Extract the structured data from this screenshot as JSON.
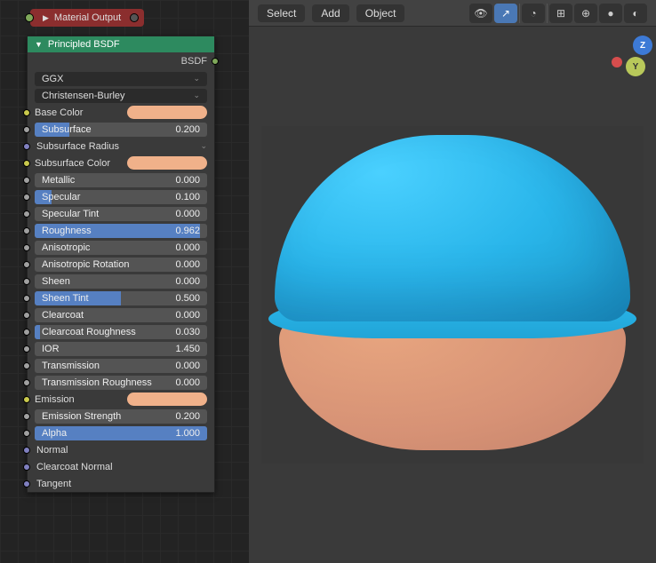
{
  "header": {
    "select": "Select",
    "add": "Add",
    "object": "Object"
  },
  "gizmo": {
    "z": "Z",
    "y": "Y"
  },
  "mat_output_label": "Material Output",
  "node": {
    "title": "Principled BSDF",
    "out": "BSDF",
    "dist": "GGX",
    "sss_method": "Christensen-Burley",
    "base_color": "Base Color",
    "subsurface": {
      "label": "Subsurface",
      "value": "0.200",
      "fill": 20
    },
    "sub_radius": "Subsurface Radius",
    "sub_color": "Subsurface Color",
    "metallic": {
      "label": "Metallic",
      "value": "0.000",
      "fill": 0
    },
    "specular": {
      "label": "Specular",
      "value": "0.100",
      "fill": 10
    },
    "spec_tint": {
      "label": "Specular Tint",
      "value": "0.000",
      "fill": 0
    },
    "roughness": {
      "label": "Roughness",
      "value": "0.962",
      "fill": 96
    },
    "aniso": {
      "label": "Anisotropic",
      "value": "0.000",
      "fill": 0
    },
    "aniso_rot": {
      "label": "Anisotropic Rotation",
      "value": "0.000",
      "fill": 0
    },
    "sheen": {
      "label": "Sheen",
      "value": "0.000",
      "fill": 0
    },
    "sheen_tint": {
      "label": "Sheen Tint",
      "value": "0.500",
      "fill": 50
    },
    "clearcoat": {
      "label": "Clearcoat",
      "value": "0.000",
      "fill": 0
    },
    "cc_rough": {
      "label": "Clearcoat Roughness",
      "value": "0.030",
      "fill": 3
    },
    "ior": {
      "label": "IOR",
      "value": "1.450",
      "fill": 0
    },
    "trans": {
      "label": "Transmission",
      "value": "0.000",
      "fill": 0
    },
    "trans_rough": {
      "label": "Transmission Roughness",
      "value": "0.000",
      "fill": 0
    },
    "emission": "Emission",
    "emit_str": {
      "label": "Emission Strength",
      "value": "0.200",
      "fill": 0
    },
    "alpha": {
      "label": "Alpha",
      "value": "1.000",
      "fill": 100
    },
    "normal": "Normal",
    "cc_normal": "Clearcoat Normal",
    "tangent": "Tangent"
  }
}
